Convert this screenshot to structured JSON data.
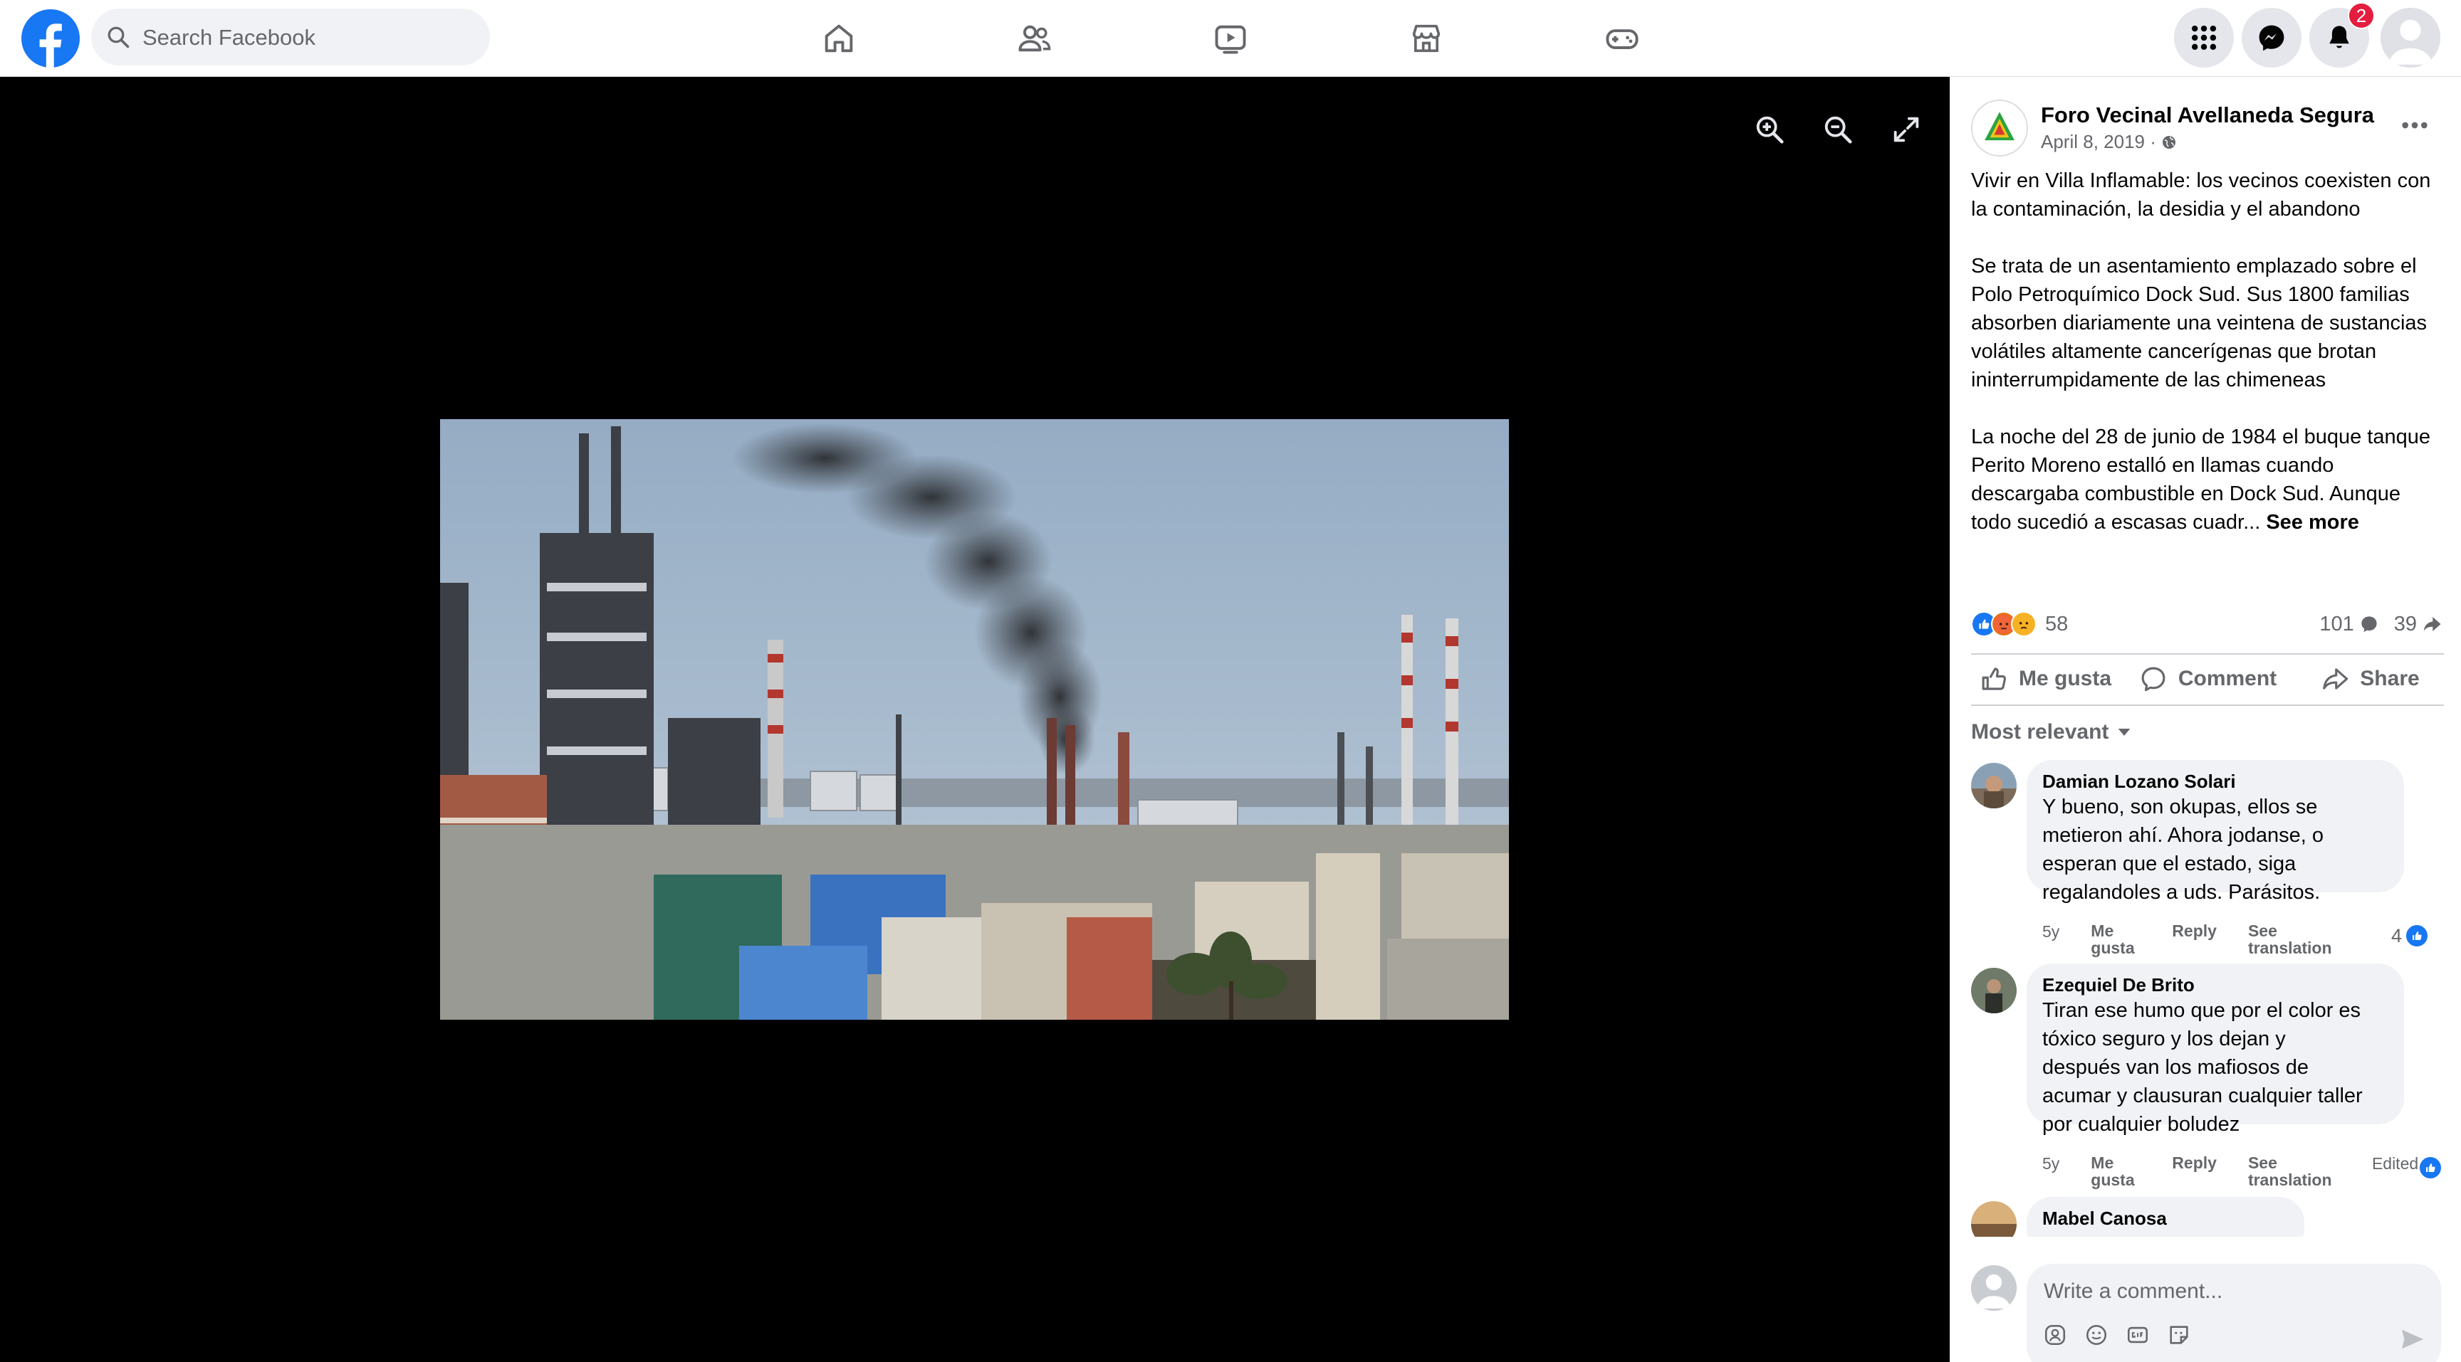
{
  "header": {
    "search_placeholder": "Search Facebook",
    "notification_count": "2",
    "nav": [
      "home",
      "friends",
      "watch",
      "marketplace",
      "gaming"
    ]
  },
  "viewer": {
    "controls": [
      "zoom-in",
      "zoom-out",
      "fullscreen"
    ]
  },
  "post": {
    "page_name": "Foro Vecinal Avellaneda Segura",
    "date": "April 8, 2019 ·",
    "paragraphs": [
      "Vivir en Villa Inflamable: los vecinos coexisten con la contaminación, la desidia y el abandono",
      "Se trata de un asentamiento emplazado sobre el Polo Petroquímico Dock Sud. Sus 1800 familias absorben diariamente una veintena de sustancias volátiles altamente cancerígenas que brotan ininterrumpidamente de las chimeneas",
      "La noche del 28 de junio de 1984 el buque tanque Perito Moreno estalló en llamas cuando descargaba combustible en Dock Sud. Aunque todo sucedió a escasas cuadr..."
    ],
    "see_more": "See more",
    "reaction_count": "58",
    "comment_count": "101",
    "share_count": "39",
    "actions": {
      "like": "Me gusta",
      "comment": "Comment",
      "share": "Share"
    },
    "sort_label": "Most relevant"
  },
  "comments": [
    {
      "author": "Damian Lozano Solari",
      "lines": [
        "Y bueno, son okupas, ellos se",
        "metieron ahí. Ahora jodanse, o",
        "esperan que el estado, siga",
        "regalandoles a uds. Parásitos."
      ],
      "time": "5y",
      "like": "Me gusta",
      "reply": "Reply",
      "translate": "See translation",
      "likes": "4",
      "edited": ""
    },
    {
      "author": "Ezequiel De Brito",
      "lines": [
        "Tiran ese humo que por el color es",
        "tóxico seguro y los dejan y",
        "después van los mafiosos de",
        "acumar y clausuran cualquier taller",
        "por cualquier boludez"
      ],
      "time": "5y",
      "like": "Me gusta",
      "reply": "Reply",
      "translate": "See translation",
      "likes": "",
      "edited": "Edited"
    },
    {
      "author": "Mabel Canosa"
    }
  ],
  "composer": {
    "placeholder": "Write a comment..."
  },
  "colors": {
    "brand": "#1877f2",
    "badge": "#e41e3f",
    "secondary_text": "#65676b",
    "bubble": "#f0f2f5"
  }
}
